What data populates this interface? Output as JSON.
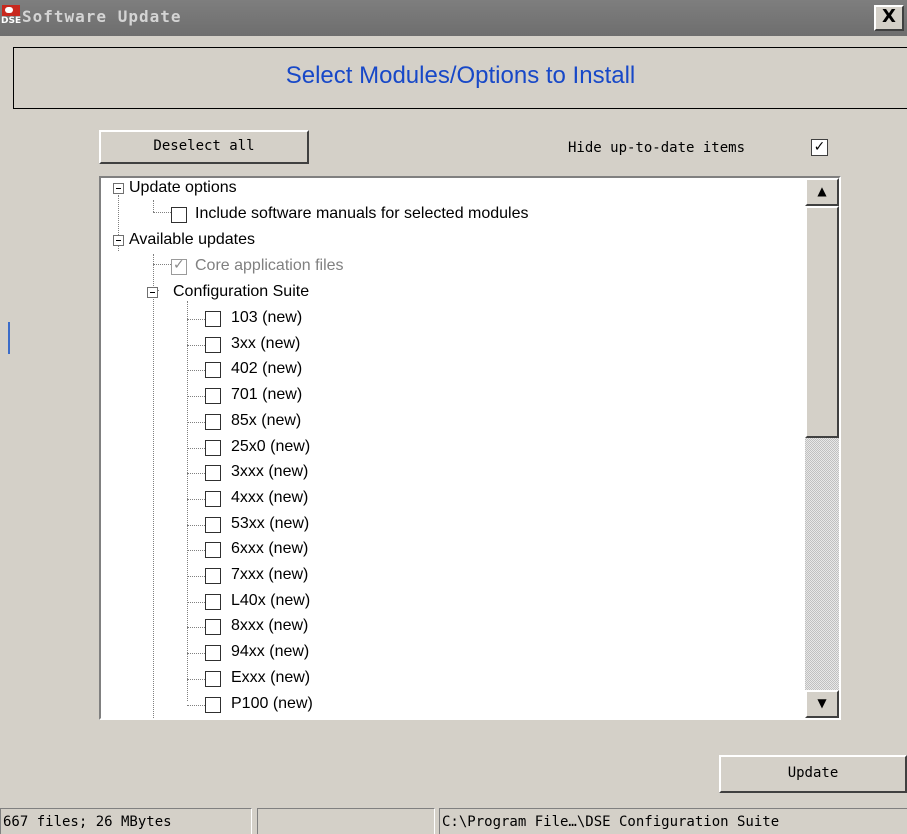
{
  "window": {
    "title": "Software Update",
    "close_label": "X",
    "icon_text": "DSE"
  },
  "header": {
    "heading": "Select Modules/Options to Install"
  },
  "toolbar": {
    "deselect_label": "Deselect all",
    "hide_label": "Hide up-to-date items",
    "hide_checked": true,
    "check_mark": "✓"
  },
  "tree": {
    "update_options": "Update options",
    "include_manuals": "Include software manuals for selected modules",
    "available_updates": "Available updates",
    "core_files": "Core application files",
    "config_suite": "Configuration Suite",
    "modules": [
      "103 (new)",
      "3xx (new)",
      "402 (new)",
      "701 (new)",
      "85x (new)",
      "25x0 (new)",
      "3xxx (new)",
      "4xxx (new)",
      "53xx (new)",
      "6xxx (new)",
      "7xxx (new)",
      "L40x (new)",
      "8xxx (new)",
      "94xx (new)",
      "Exxx (new)",
      "P100 (new)"
    ]
  },
  "scrollbar": {
    "up_arrow": "▲",
    "down_arrow": "▼"
  },
  "footer": {
    "update_label": "Update"
  },
  "statusbar": {
    "files": "667 files; 26 MBytes",
    "middle": "",
    "path": "C:\\Program File…\\DSE Configuration Suite"
  }
}
